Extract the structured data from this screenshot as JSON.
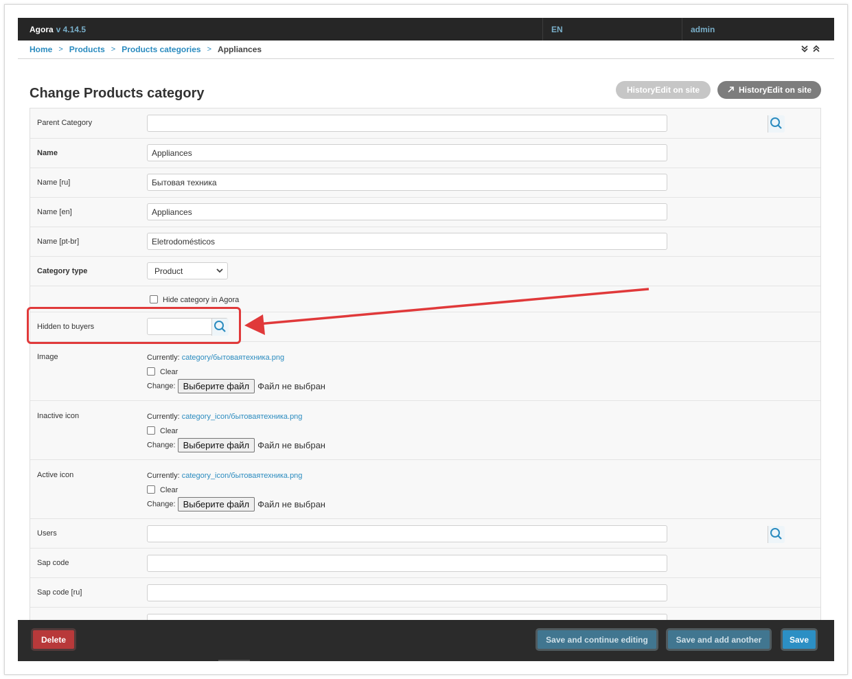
{
  "topbar": {
    "brand": "Agora",
    "version": "v 4.14.5",
    "language": "EN",
    "user": "admin"
  },
  "breadcrumb": {
    "items": [
      "Home",
      "Products",
      "Products categories"
    ],
    "current": "Appliances",
    "separator": ">"
  },
  "page": {
    "title": "Change Products category"
  },
  "actions": {
    "history_label": "HistoryEdit on site",
    "history_edit_label": "HistoryEdit on site"
  },
  "form": {
    "parent_category": {
      "label": "Parent Category",
      "value": ""
    },
    "name": {
      "label": "Name",
      "value": "Appliances"
    },
    "name_ru": {
      "label": "Name [ru]",
      "value": "Бытовая техника"
    },
    "name_en": {
      "label": "Name [en]",
      "value": "Appliances"
    },
    "name_ptbr": {
      "label": "Name [pt-br]",
      "value": "Eletrodomésticos"
    },
    "category_type": {
      "label": "Category type",
      "value": "Product"
    },
    "hide_category": {
      "label": "Hide category in Agora",
      "checked": false
    },
    "hidden_to_buyers": {
      "label": "Hidden to buyers",
      "value": ""
    },
    "currently_label": "Currently:",
    "clear_label": "Clear",
    "change_label": "Change:",
    "choose_file": "Выберите файл",
    "no_file": "Файл не выбран",
    "image": {
      "label": "Image",
      "current": "category/бытоваятехника.png"
    },
    "inactive_icon": {
      "label": "Inactive icon",
      "current": "category_icon/бытоваятехника.png"
    },
    "active_icon": {
      "label": "Active icon",
      "current": "category_icon/бытоваятехника.png"
    },
    "users": {
      "label": "Users",
      "value": ""
    },
    "sap_code": {
      "label": "Sap code",
      "value": ""
    },
    "sap_code_ru": {
      "label": "Sap code [ru]",
      "value": ""
    }
  },
  "footer": {
    "delete": "Delete",
    "save_continue": "Save and continue editing",
    "save_another": "Save and add another",
    "save": "Save"
  },
  "colors": {
    "topbar": "#262626",
    "link": "#2a8bbf",
    "delete": "#b8393a",
    "primary": "#417690",
    "save": "#2c8fc4",
    "annotation": "#e0393a"
  }
}
